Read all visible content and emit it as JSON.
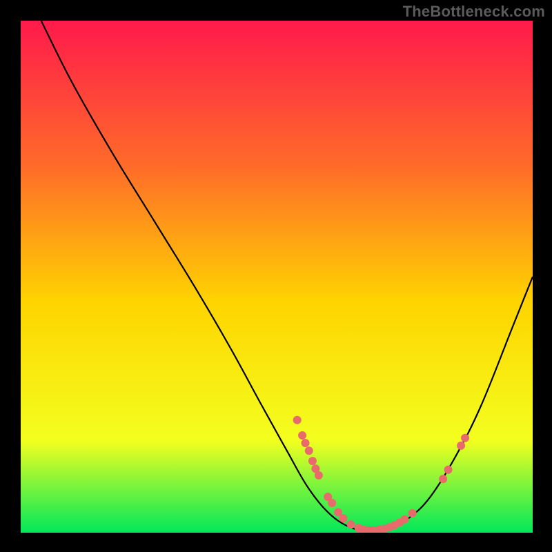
{
  "watermark": "TheBottleneck.com",
  "colors": {
    "background": "#000000",
    "gradient_top": "#ff1a4b",
    "gradient_mid_upper": "#ff6a2a",
    "gradient_mid": "#ffd400",
    "gradient_mid_lower": "#f3ff1f",
    "gradient_bottom": "#00e85a",
    "curve_stroke": "#000000",
    "marker_fill": "#e86a6a"
  },
  "chart_data": {
    "type": "line",
    "title": "",
    "xlabel": "",
    "ylabel": "",
    "xlim": [
      0,
      100
    ],
    "ylim": [
      0,
      100
    ],
    "curve": [
      {
        "x": 4,
        "y": 100
      },
      {
        "x": 10,
        "y": 88
      },
      {
        "x": 18,
        "y": 74
      },
      {
        "x": 26,
        "y": 61
      },
      {
        "x": 34,
        "y": 48
      },
      {
        "x": 41,
        "y": 36
      },
      {
        "x": 47,
        "y": 25
      },
      {
        "x": 52,
        "y": 16
      },
      {
        "x": 56,
        "y": 9
      },
      {
        "x": 60,
        "y": 4
      },
      {
        "x": 64,
        "y": 1.2
      },
      {
        "x": 68,
        "y": 0.3
      },
      {
        "x": 72,
        "y": 0.8
      },
      {
        "x": 76,
        "y": 3
      },
      {
        "x": 80,
        "y": 7
      },
      {
        "x": 85,
        "y": 15
      },
      {
        "x": 90,
        "y": 25
      },
      {
        "x": 96,
        "y": 40
      },
      {
        "x": 100,
        "y": 50
      }
    ],
    "markers": [
      {
        "x": 54,
        "y": 22
      },
      {
        "x": 55,
        "y": 19
      },
      {
        "x": 55.6,
        "y": 17.5
      },
      {
        "x": 56.3,
        "y": 16
      },
      {
        "x": 57,
        "y": 14
      },
      {
        "x": 57.6,
        "y": 12.5
      },
      {
        "x": 58.2,
        "y": 11.2
      },
      {
        "x": 60,
        "y": 7
      },
      {
        "x": 60.8,
        "y": 5.8
      },
      {
        "x": 62,
        "y": 4
      },
      {
        "x": 63,
        "y": 2.8
      },
      {
        "x": 64.5,
        "y": 1.6
      },
      {
        "x": 66,
        "y": 0.9
      },
      {
        "x": 67,
        "y": 0.6
      },
      {
        "x": 68,
        "y": 0.45
      },
      {
        "x": 69,
        "y": 0.45
      },
      {
        "x": 70,
        "y": 0.55
      },
      {
        "x": 71,
        "y": 0.75
      },
      {
        "x": 72,
        "y": 1.05
      },
      {
        "x": 73,
        "y": 1.45
      },
      {
        "x": 74,
        "y": 1.95
      },
      {
        "x": 75,
        "y": 2.6
      },
      {
        "x": 76.5,
        "y": 3.8
      },
      {
        "x": 82.5,
        "y": 10.5
      },
      {
        "x": 83.5,
        "y": 12.3
      },
      {
        "x": 86,
        "y": 17
      },
      {
        "x": 86.8,
        "y": 18.5
      }
    ]
  }
}
